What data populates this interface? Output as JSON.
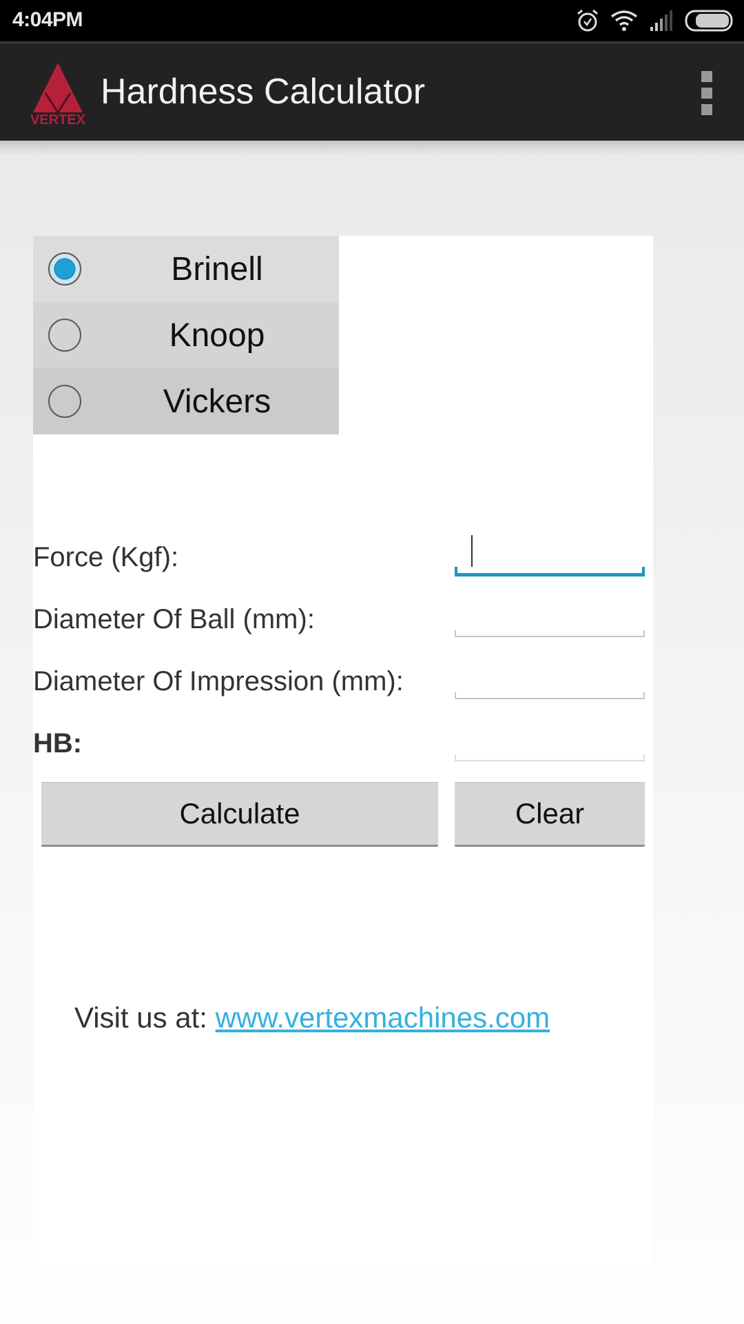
{
  "status_bar": {
    "time": "4:04PM",
    "icons": [
      "alarm-icon",
      "wifi-icon",
      "signal-icon",
      "battery-icon"
    ]
  },
  "action_bar": {
    "logo_text": "VERTEX",
    "title": "Hardness Calculator",
    "overflow_icon": "more-vert-icon"
  },
  "colors": {
    "accent": "#1a96c6",
    "logo_red": "#b5203a",
    "link": "#33b0e0",
    "action_bar_bg": "#222222"
  },
  "hardness_types": {
    "selected": "Brinell",
    "options": [
      {
        "label": "Brinell",
        "checked": true
      },
      {
        "label": "Knoop",
        "checked": false
      },
      {
        "label": "Vickers",
        "checked": false
      }
    ]
  },
  "form": {
    "fields": [
      {
        "label": "Force (Kgf):",
        "value": "",
        "focused": true
      },
      {
        "label": "Diameter Of Ball (mm):",
        "value": "",
        "focused": false
      },
      {
        "label": "Diameter Of Impression (mm):",
        "value": "",
        "focused": false
      }
    ],
    "result": {
      "label": "HB:",
      "value": ""
    }
  },
  "buttons": {
    "calculate": "Calculate",
    "clear": "Clear"
  },
  "footer": {
    "prefix": "Visit us at: ",
    "link_text": "www.vertexmachines.com"
  }
}
